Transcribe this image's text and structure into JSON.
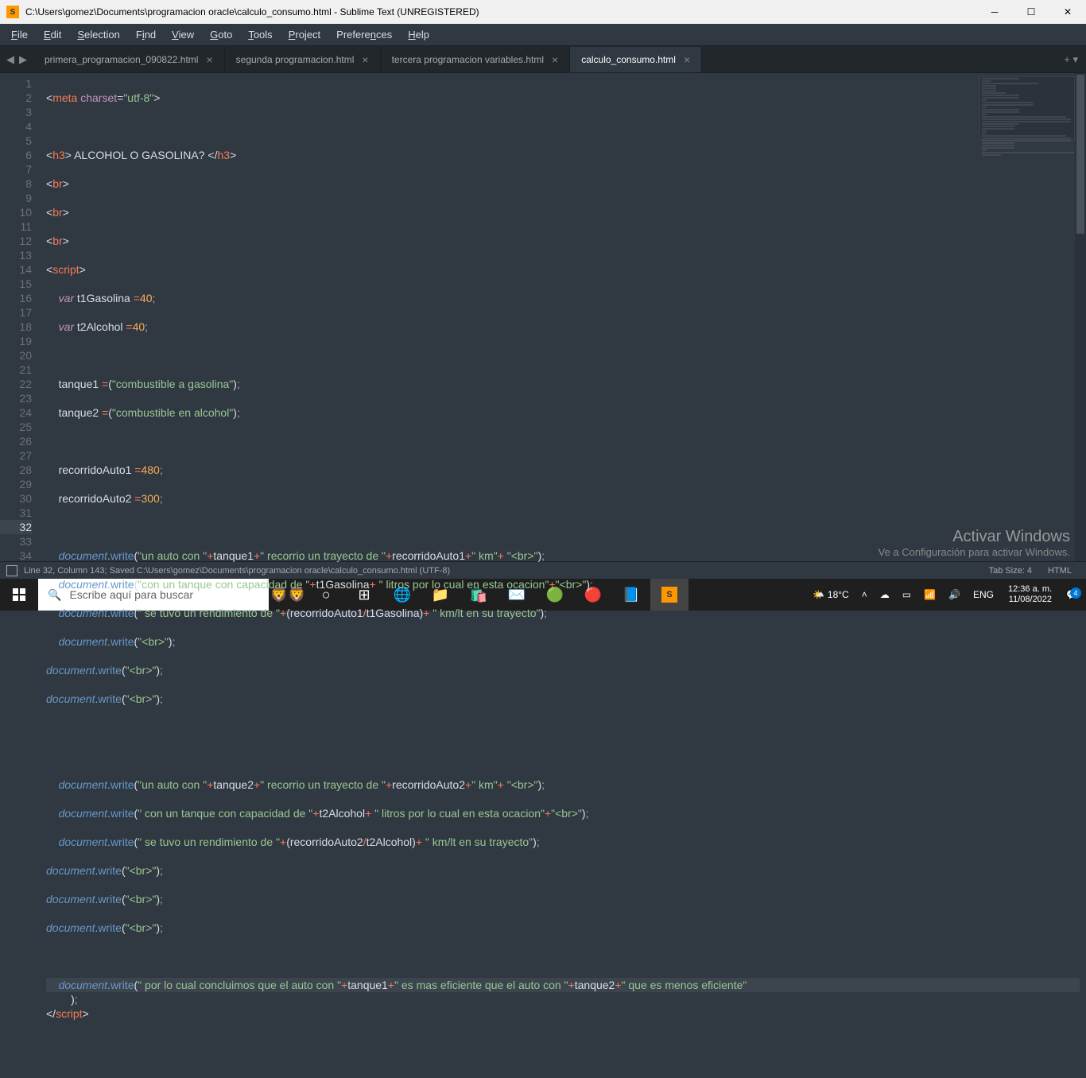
{
  "titlebar": {
    "icon_letter": "S",
    "path": "C:\\Users\\gomez\\Documents\\programacion oracle\\calculo_consumo.html - Sublime Text (UNREGISTERED)"
  },
  "menu": {
    "items": [
      "File",
      "Edit",
      "Selection",
      "Find",
      "View",
      "Goto",
      "Tools",
      "Project",
      "Preferences",
      "Help"
    ]
  },
  "tabs": {
    "nav_prev": "◀",
    "nav_next": "▶",
    "list": [
      {
        "label": "primera_programacion_090822.html",
        "active": false
      },
      {
        "label": "segunda programacion.html",
        "active": false
      },
      {
        "label": "tercera programacion variables.html",
        "active": false
      },
      {
        "label": "calculo_consumo.html",
        "active": true
      }
    ],
    "add": "+",
    "menu": "▾"
  },
  "gutter": {
    "lines": 34,
    "active": 32
  },
  "code": {
    "active_line": 32
  },
  "statusbar": {
    "left": "Line 32, Column 143; Saved C:\\Users\\gomez\\Documents\\programacion oracle\\calculo_consumo.html (UTF-8)",
    "tabsize": "Tab Size: 4",
    "lang": "HTML"
  },
  "watermark": {
    "line1": "Activar Windows",
    "line2": "Ve a Configuración para activar Windows."
  },
  "taskbar": {
    "search_placeholder": "Escribe aquí para buscar",
    "weather_temp": "18°C",
    "lang": "ENG",
    "time": "12:36 a. m.",
    "date": "11/08/2022",
    "notif_count": "4"
  },
  "chart_data": null
}
